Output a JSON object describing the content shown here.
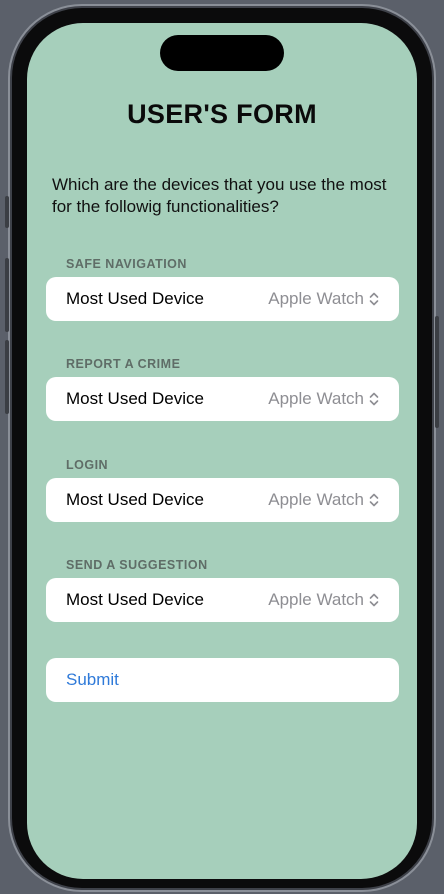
{
  "form": {
    "title": "USER'S FORM",
    "question": "Which are the devices that you use the most for the followig functionalities?",
    "sections": [
      {
        "header": "SAFE NAVIGATION",
        "row_label": "Most Used Device",
        "selected": "Apple Watch"
      },
      {
        "header": "REPORT A CRIME",
        "row_label": "Most Used Device",
        "selected": "Apple Watch"
      },
      {
        "header": "LOGIN",
        "row_label": "Most Used Device",
        "selected": "Apple Watch"
      },
      {
        "header": "SEND A SUGGESTION",
        "row_label": "Most Used Device",
        "selected": "Apple Watch"
      }
    ],
    "submit_label": "Submit"
  },
  "colors": {
    "background": "#a6cfbb",
    "accent": "#2f7ad9",
    "picker_text": "#8e8e93"
  },
  "icons": {
    "picker": "chevron-up-down-icon"
  }
}
